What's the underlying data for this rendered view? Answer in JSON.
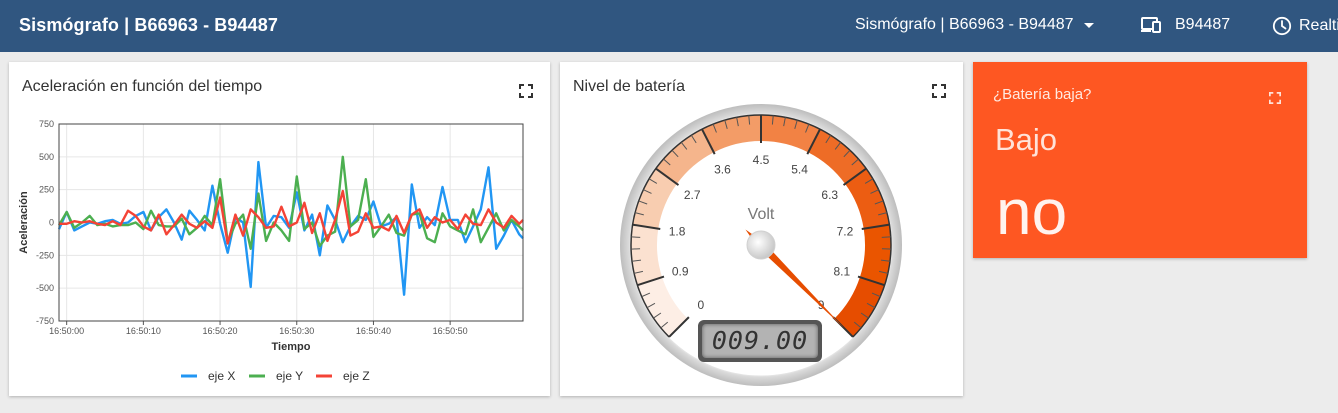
{
  "topbar": {
    "app_title": "Sismógrafo | B66963 - B94487",
    "dashboard_selector": "Sismógrafo | B66963 - B94487",
    "device": "B94487",
    "time_window": "Realtime"
  },
  "chart_card": {
    "title": "Aceleración en función del tiempo",
    "icons": {
      "fullscreen": "fullscreen-icon"
    }
  },
  "gauge_card": {
    "title": "Nivel de batería",
    "units": "Volt",
    "value": 9.0,
    "display": "009.00",
    "min": 0,
    "max": 9,
    "ticks": [
      "0",
      "0.9",
      "1.8",
      "2.7",
      "3.6",
      "4.5",
      "5.4",
      "6.3",
      "7.2",
      "8.1",
      "9"
    ],
    "color_bands": [
      "#fdeee5",
      "#fbe1d0",
      "#f8cdb0",
      "#f5b58c",
      "#f39c67",
      "#f28244",
      "#ee6c26",
      "#ec5d12",
      "#ea5500",
      "#e64d00"
    ]
  },
  "alarm_card": {
    "title": "¿Batería baja?",
    "state": "Bajo",
    "value": "no",
    "color": "#fe5722"
  },
  "chart_data": {
    "type": "line",
    "xlabel": "Tiempo",
    "ylabel": "Aceleración",
    "ylim": [
      -750,
      750
    ],
    "yticks": [
      -750,
      -500,
      -250,
      0,
      250,
      500,
      750
    ],
    "xticks": [
      "16:50:00",
      "16:50:10",
      "16:50:20",
      "16:50:30",
      "16:50:40",
      "16:50:50"
    ],
    "xtick_seconds": [
      0,
      10,
      20,
      30,
      40,
      50
    ],
    "xlim_seconds": [
      -1,
      59.5
    ],
    "grid": true,
    "legend": "bottom",
    "x_seconds": [
      -1,
      0,
      1,
      2,
      3,
      4,
      5,
      6,
      7,
      8,
      9,
      10,
      11,
      12,
      13,
      14,
      15,
      16,
      17,
      18,
      19,
      20,
      21,
      22,
      23,
      24,
      25,
      26,
      27,
      28,
      29,
      30,
      31,
      32,
      33,
      34,
      35,
      36,
      37,
      38,
      39,
      40,
      41,
      42,
      43,
      44,
      45,
      46,
      47,
      48,
      49,
      50,
      51,
      52,
      53,
      54,
      55,
      56,
      57,
      58,
      59,
      59.5
    ],
    "series": [
      {
        "name": "eje X",
        "color": "#2196f3",
        "values": [
          -50,
          80,
          -60,
          -30,
          0,
          -10,
          10,
          20,
          -10,
          0,
          50,
          80,
          -60,
          40,
          100,
          0,
          -130,
          90,
          20,
          -60,
          280,
          -10,
          -230,
          40,
          0,
          -490,
          460,
          -40,
          50,
          40,
          -40,
          230,
          -60,
          60,
          -250,
          130,
          20,
          -150,
          -30,
          50,
          20,
          160,
          -30,
          -10,
          40,
          -550,
          290,
          -40,
          40,
          -20,
          270,
          20,
          20,
          -150,
          -30,
          100,
          420,
          -200,
          -100,
          20,
          -90,
          -120
        ]
      },
      {
        "name": "eje Y",
        "color": "#4caf50",
        "values": [
          -20,
          80,
          -40,
          0,
          50,
          -20,
          -10,
          -30,
          -20,
          -20,
          0,
          -50,
          90,
          -20,
          -30,
          -30,
          30,
          -90,
          -40,
          50,
          -20,
          330,
          -150,
          -10,
          60,
          -200,
          220,
          -140,
          0,
          -60,
          -140,
          350,
          -50,
          0,
          -180,
          -100,
          -70,
          500,
          -30,
          20,
          330,
          -110,
          -30,
          60,
          -80,
          -100,
          60,
          70,
          -120,
          -150,
          70,
          -30,
          -60,
          -90,
          100,
          -150,
          -40,
          70,
          -60,
          20,
          -30,
          -60
        ]
      },
      {
        "name": "eje Z",
        "color": "#f44336",
        "values": [
          -10,
          -10,
          10,
          0,
          10,
          -10,
          -20,
          10,
          -20,
          90,
          50,
          -30,
          -60,
          60,
          -90,
          -20,
          60,
          -10,
          -40,
          10,
          -40,
          190,
          -160,
          60,
          -100,
          100,
          40,
          -40,
          -30,
          120,
          -30,
          0,
          150,
          -80,
          70,
          -140,
          20,
          240,
          -100,
          -70,
          70,
          -40,
          -30,
          -60,
          50,
          -80,
          60,
          100,
          -40,
          40,
          0,
          20,
          -50,
          60,
          -10,
          -20,
          100,
          0,
          -40,
          50,
          -10,
          20
        ]
      }
    ]
  }
}
